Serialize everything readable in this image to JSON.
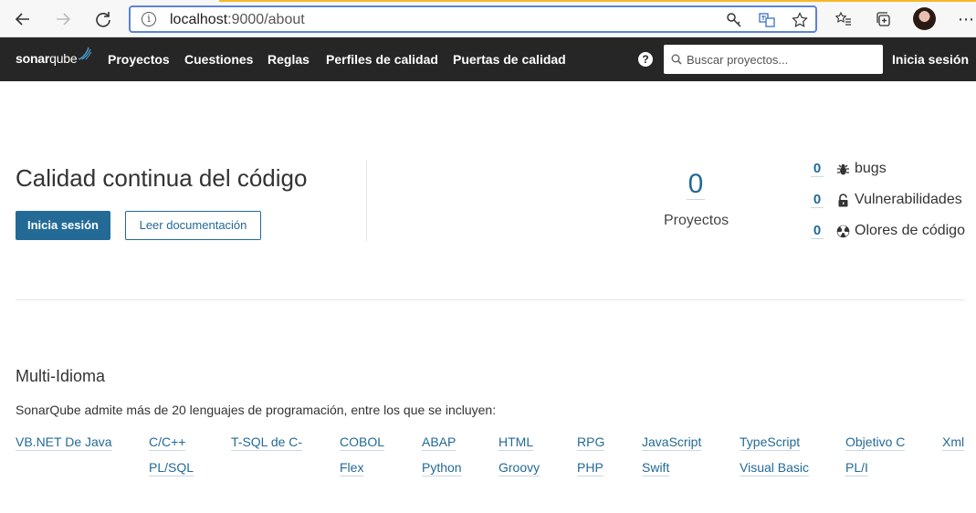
{
  "browser": {
    "url_host": "localhost",
    "url_path": ":9000/about"
  },
  "nav": {
    "logo_bold": "sonar",
    "logo_light": "qube",
    "items": [
      "Proyectos",
      "Cuestiones",
      "Reglas",
      "Perfiles de calidad",
      "Puertas de calidad"
    ],
    "search_placeholder": "Buscar proyectos...",
    "login": "Inicia sesión"
  },
  "hero": {
    "title": "Calidad continua del código",
    "login_button": "Inicia sesión",
    "docs_button": "Leer documentación",
    "projects_count": "0",
    "projects_label": "Proyectos",
    "metrics": [
      {
        "count": "0",
        "label": "bugs",
        "icon": "bug-icon"
      },
      {
        "count": "0",
        "label": "Vulnerabilidades",
        "icon": "lock-icon"
      },
      {
        "count": "0",
        "label": "Olores de código",
        "icon": "code-smell-icon"
      }
    ]
  },
  "languages": {
    "title": "Multi-Idioma",
    "description": "SonarQube admite más de 20 lenguajes de programación, entre los que se incluyen:",
    "row1": [
      "VB.NET De Java",
      "C/C++",
      "T-SQL de C-",
      "COBOL",
      "ABAP",
      "HTML",
      "RPG",
      "JavaScript",
      "TypeScript",
      "Objetivo C",
      "Xml"
    ],
    "row2": [
      "PL/SQL",
      "Flex",
      "Python",
      "Groovy",
      "PHP",
      "Swift",
      "Visual Basic",
      "PL/I"
    ]
  },
  "colors": {
    "accent": "#236a97",
    "nav_bg": "#262626"
  }
}
